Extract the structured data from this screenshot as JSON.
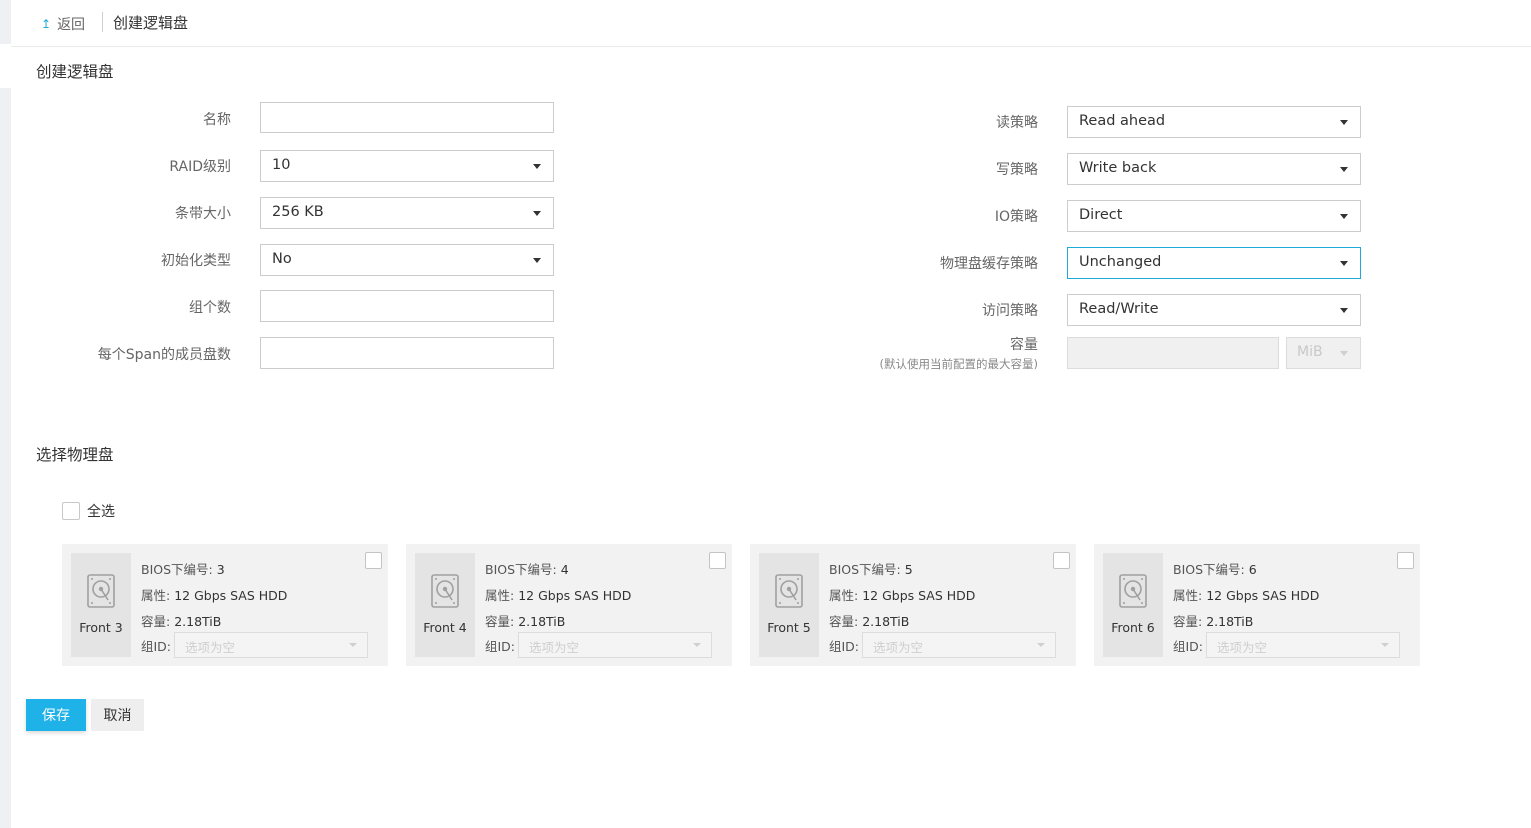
{
  "header": {
    "back_label": "返回",
    "back_icon": "up-arrow-icon",
    "title": "创建逻辑盘"
  },
  "section_create": {
    "title": "创建逻辑盘"
  },
  "form_left": {
    "name": {
      "label": "名称",
      "value": ""
    },
    "raid_level": {
      "label": "RAID级别",
      "value": "10"
    },
    "stripe_size": {
      "label": "条带大小",
      "value": "256 KB"
    },
    "init_type": {
      "label": "初始化类型",
      "value": "No"
    },
    "group_count": {
      "label": "组个数",
      "value": ""
    },
    "span_members": {
      "label": "每个Span的成员盘数",
      "value": ""
    }
  },
  "form_right": {
    "read_policy": {
      "label": "读策略",
      "value": "Read ahead"
    },
    "write_policy": {
      "label": "写策略",
      "value": "Write back"
    },
    "io_policy": {
      "label": "IO策略",
      "value": "Direct"
    },
    "disk_cache_policy": {
      "label": "物理盘缓存策略",
      "value": "Unchanged"
    },
    "access_policy": {
      "label": "访问策略",
      "value": "Read/Write"
    },
    "capacity": {
      "label": "容量",
      "hint": "(默认使用当前配置的最大容量)",
      "value": "",
      "unit": "MiB"
    }
  },
  "section_disks": {
    "title": "选择物理盘",
    "select_all_label": "全选"
  },
  "disks": [
    {
      "name": "Front 3",
      "bios_label": "BIOS下编号:",
      "bios": "3",
      "attr_label": "属性:",
      "attr": "12 Gbps SAS HDD",
      "cap_label": "容量:",
      "capacity": "2.18TiB",
      "group_label": "组ID:",
      "group_placeholder": "选项为空"
    },
    {
      "name": "Front 4",
      "bios_label": "BIOS下编号:",
      "bios": "4",
      "attr_label": "属性:",
      "attr": "12 Gbps SAS HDD",
      "cap_label": "容量:",
      "capacity": "2.18TiB",
      "group_label": "组ID:",
      "group_placeholder": "选项为空"
    },
    {
      "name": "Front 5",
      "bios_label": "BIOS下编号:",
      "bios": "5",
      "attr_label": "属性:",
      "attr": "12 Gbps SAS HDD",
      "cap_label": "容量:",
      "capacity": "2.18TiB",
      "group_label": "组ID:",
      "group_placeholder": "选项为空"
    },
    {
      "name": "Front 6",
      "bios_label": "BIOS下编号:",
      "bios": "6",
      "attr_label": "属性:",
      "attr": "12 Gbps SAS HDD",
      "cap_label": "容量:",
      "capacity": "2.18TiB",
      "group_label": "组ID:",
      "group_placeholder": "选项为空"
    }
  ],
  "actions": {
    "save": "保存",
    "cancel": "取消"
  },
  "colors": {
    "accent": "#1fb2e8",
    "border": "#cccccc",
    "card_bg": "#f2f2f2"
  }
}
